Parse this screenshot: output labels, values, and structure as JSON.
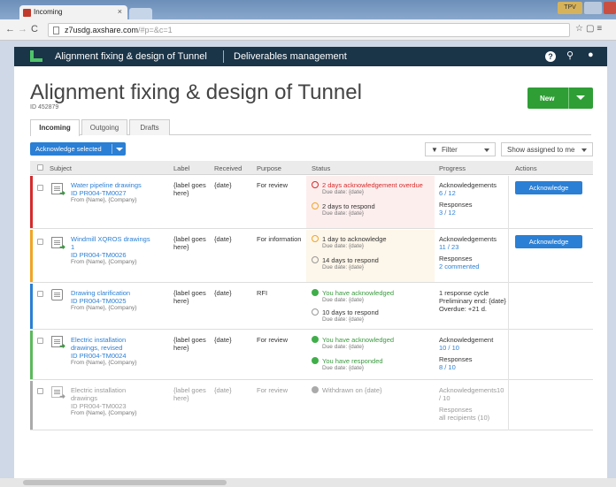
{
  "browser": {
    "tab_title": "Incoming",
    "url_host": "z7usdg.axshare.com",
    "url_rest": "/#p=&c=1",
    "min_label": "TPV"
  },
  "app": {
    "title": "Alignment fixing & design of Tunnel",
    "section": "Deliverables management"
  },
  "page": {
    "title": "Alignment fixing & design of Tunnel",
    "id": "ID 452879",
    "new_label": "New",
    "tabs": [
      "Incoming",
      "Outgoing",
      "Drafts"
    ],
    "ack_selected_label": "Acknowledge selected",
    "filter_label": "Filter",
    "show_label": "Show assigned to me"
  },
  "table": {
    "headers": [
      "Subject",
      "Label",
      "Received",
      "Purpose",
      "Status",
      "Progress",
      "Actions"
    ],
    "rows": [
      {
        "stripe": "#d62b2b",
        "subject": "Water pipeline drawings",
        "subject2": "",
        "doc_id": "ID PR004-TM0027",
        "from": "From {Name}, {Company}",
        "label": "{label goes here}",
        "received": "{date}",
        "purpose": "For review",
        "s1": "2 days acknowledgement overdue",
        "s1_due": "Due date: {date}",
        "s2": "2 days to respond",
        "s2_due": "Due date: {date}",
        "p1": "Acknowledgements",
        "p1v": "6 / 12",
        "p2": "Responses",
        "p2v": "3 / 12",
        "action": "Acknowledge"
      },
      {
        "stripe": "#f0a526",
        "subject": "Windmill XQROS drawings",
        "subject2": "1",
        "doc_id": "ID PR004-TM0026",
        "from": "From {Name}, {Company}",
        "label": "{label goes here}",
        "received": "{date}",
        "purpose": "For information",
        "s1": "1 day to acknowledge",
        "s1_due": "Due date: {date}",
        "s2": "14 days to respond",
        "s2_due": "Due date: {date}",
        "p1": "Acknowledgements",
        "p1v": "11 / 23",
        "p2": "Responses",
        "p2v": "2 commented",
        "action": "Acknowledge"
      },
      {
        "stripe": "#2b7fd4",
        "subject": "Drawing clarification",
        "doc_id": "ID PR004-TM0025",
        "from": "From {Name}, {Company}",
        "label": "{label goes here}",
        "received": "{date}",
        "purpose": "RFI",
        "s1": "You have acknowledged",
        "s1_due": "Due date: {date}",
        "s2": "10 days to respond",
        "s2_due": "Due date: {date}",
        "p1": "1 response cycle",
        "p1v": "Preliminary end: {date}",
        "p2": "Overdue: +21 d."
      },
      {
        "stripe": "#5cb85c",
        "subject": "Electric installation",
        "subject2": "drawings, revised",
        "doc_id": "ID PR004-TM0024",
        "from": "From {Name}, {Company}",
        "label": "{label goes here}",
        "received": "{date}",
        "purpose": "For review",
        "s1": "You have acknowledged",
        "s1_due": "Due date: {date}",
        "s2": "You have responded",
        "s2_due": "Due date: {date}",
        "p1": "Acknowledgement",
        "p1v": "10 / 10",
        "p2": "Responses",
        "p2v": "8 / 10"
      },
      {
        "stripe": "#aaaaaa",
        "subject": "Electric installation",
        "subject2": "drawings",
        "doc_id": "ID PR004-TM0023",
        "from": "From {Name}, {Company}",
        "label": "{label goes here}",
        "received": "{date}",
        "purpose": "For review",
        "s1": "Withdrawn on {date}",
        "p1": "Acknowledgements10",
        "p1v": "/ 10",
        "p2": "Responses",
        "p2v": "all recipients (10)"
      }
    ]
  }
}
